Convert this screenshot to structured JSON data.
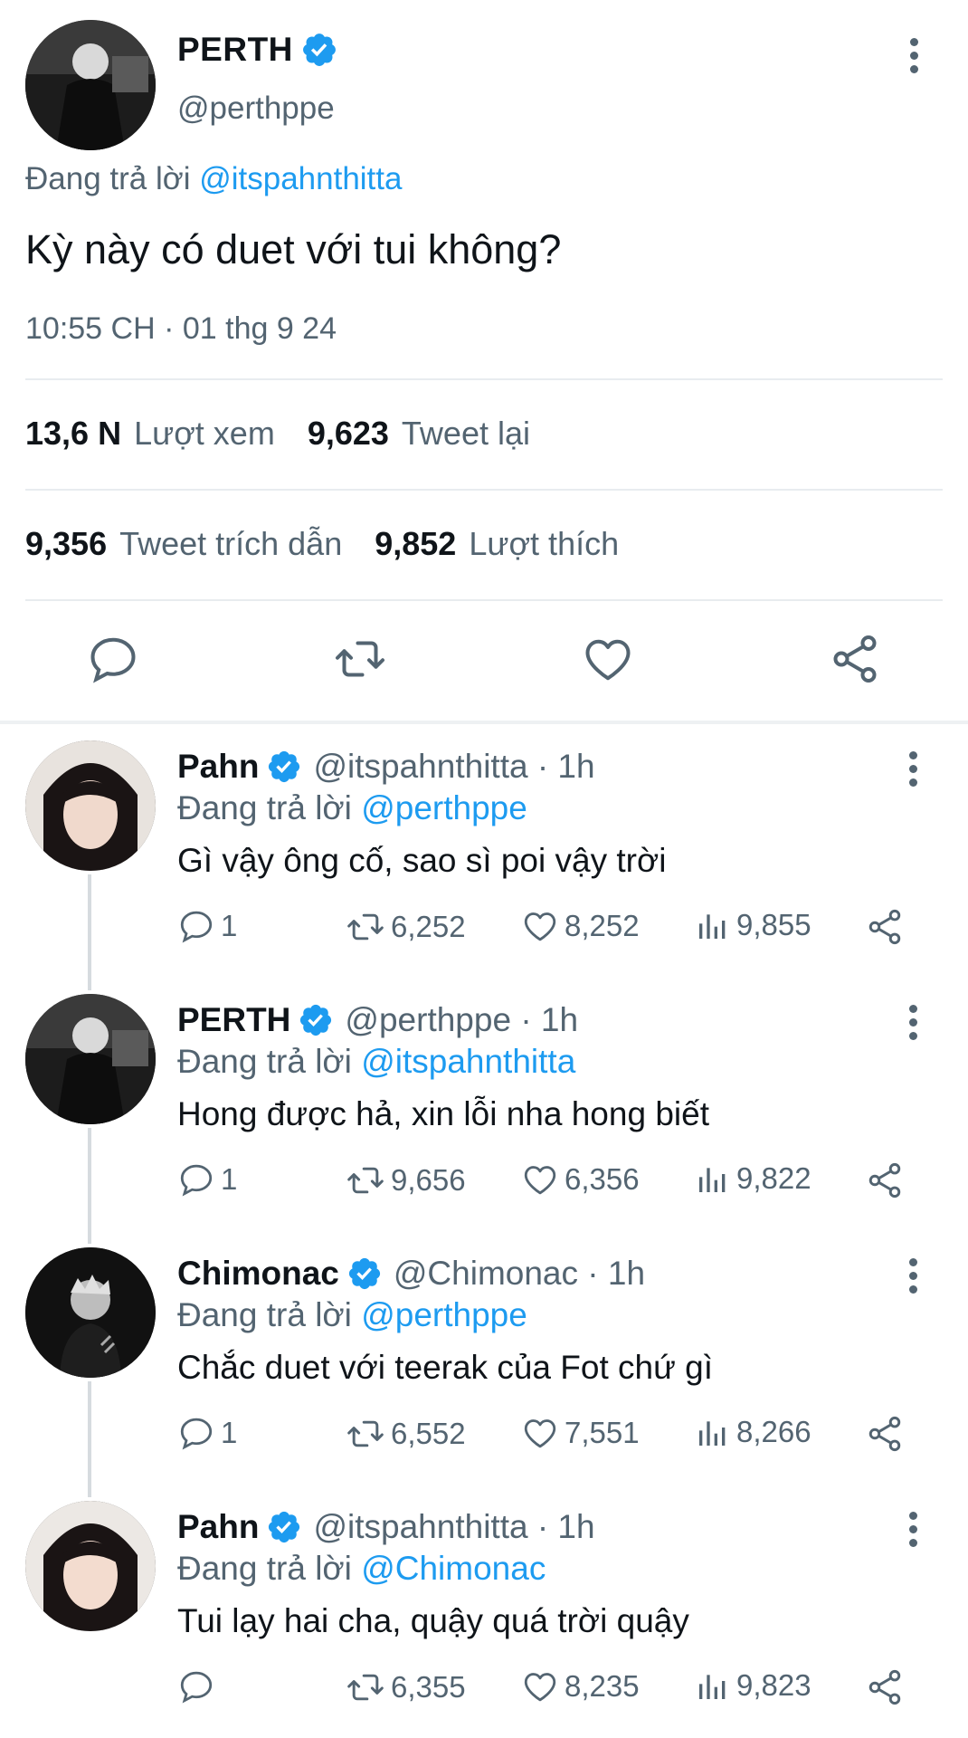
{
  "main_tweet": {
    "name": "PERTH",
    "handle": "@perthppe",
    "replying_label": "Đang trả lời ",
    "replying_to": "@itspahnthitta",
    "text": "Kỳ này có duet với tui không?",
    "timestamp": "10:55 CH · 01 thg 9 24",
    "views_count": "13,6 N",
    "views_label": "Lượt xem",
    "retweets_count": "9,623",
    "retweets_label": "Tweet lại",
    "quotes_count": "9,356",
    "quotes_label": "Tweet trích dẫn",
    "likes_count": "9,852",
    "likes_label": "Lượt thích"
  },
  "replies": [
    {
      "name": "Pahn",
      "handle": "@itspahnthitta · 1h",
      "replying_label": "Đang trả lời ",
      "replying_to": "@perthppe",
      "text": "Gì vậy ông cố, sao sì poi vậy trời",
      "replies": "1",
      "retweets": "6,252",
      "likes": "8,252",
      "views": "9,855"
    },
    {
      "name": "PERTH",
      "handle": "@perthppe · 1h",
      "replying_label": "Đang trả lời ",
      "replying_to": "@itspahnthitta",
      "text": "Hong được hả, xin lỗi nha hong biết",
      "replies": "1",
      "retweets": "9,656",
      "likes": "6,356",
      "views": "9,822"
    },
    {
      "name": "Chimonac",
      "handle": "@Chimonac · 1h",
      "replying_label": "Đang trả lời ",
      "replying_to": "@perthppe",
      "text": "Chắc duet với teerak của Fot chứ gì",
      "replies": "1",
      "retweets": "6,552",
      "likes": "7,551",
      "views": "8,266"
    },
    {
      "name": "Pahn",
      "handle": "@itspahnthitta · 1h",
      "replying_label": "Đang trả lời ",
      "replying_to": "@Chimonac",
      "text": "Tui lạy hai cha, quậy quá trời quậy",
      "replies": "",
      "retweets": "6,355",
      "likes": "8,235",
      "views": "9,823"
    }
  ],
  "colors": {
    "accent": "#1d9bf0",
    "secondary_text": "#536471",
    "primary_text": "#0f1419"
  },
  "icons": [
    "verified-badge-icon",
    "more-icon",
    "reply-icon",
    "retweet-icon",
    "like-icon",
    "share-icon",
    "views-icon"
  ]
}
